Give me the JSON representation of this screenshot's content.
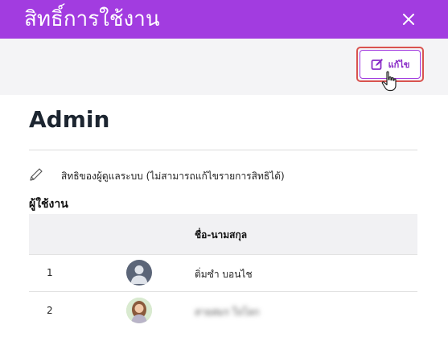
{
  "header": {
    "title": "สิทธิ์การใช้งาน",
    "bg_color": "#a23ce0"
  },
  "toolbar": {
    "edit_label": "แก้ไข",
    "accent_color": "#a23ce0",
    "highlight_color": "#d9534f"
  },
  "role": {
    "name": "Admin"
  },
  "permission": {
    "text": "สิทธิของผู้ดูแลระบบ (ไม่สามารถแก้ไขรายการสิทธิได้)"
  },
  "users": {
    "heading": "ผู้ใช้งาน",
    "columns": {
      "name": "ชื่อ-นามสกุล"
    },
    "rows": [
      {
        "index": "1",
        "name": "ติ่มซำ บอนไช",
        "avatar": "default-avatar-icon"
      },
      {
        "index": "2",
        "name": "สายสมร ใจโลก",
        "avatar": "photo-avatar"
      }
    ]
  }
}
